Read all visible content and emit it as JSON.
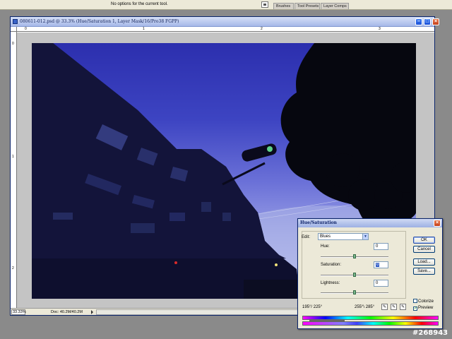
{
  "options_bar": {
    "message": "No options for the current tool.",
    "palette_tabs": [
      "Brushes",
      "Tool Presets",
      "Layer Comps"
    ]
  },
  "document": {
    "title": "080611-012.psd @ 33.3% (Hue/Saturation 1, Layer Mask/16/Pro38 FGPP)",
    "ruler_top": [
      "0",
      "1",
      "2",
      "3"
    ],
    "ruler_left": [
      "0",
      "1",
      "2"
    ],
    "zoom": "33.33%",
    "doc_size": "Doc: 40.2M/40.2M"
  },
  "dialog": {
    "title": "Hue/Saturation",
    "edit_label": "Edit:",
    "edit_value": "Blues",
    "hue_label": "Hue:",
    "hue_value": "0",
    "saturation_label": "Saturation:",
    "saturation_value": "0",
    "lightness_label": "Lightness:",
    "lightness_value": "0",
    "ok": "OK",
    "cancel": "Cancel",
    "load": "Load...",
    "save": "Save...",
    "colorize": "Colorize",
    "colorize_checked": false,
    "preview": "Preview",
    "preview_checked": true,
    "range_left": "195°/ 225°",
    "range_right": "255°\\ 285°"
  },
  "watermark": "#268943",
  "colors": {
    "titlebar": "#a6b8e8",
    "sky": "#3d44c2",
    "dialog_bg": "#ece9d8"
  }
}
